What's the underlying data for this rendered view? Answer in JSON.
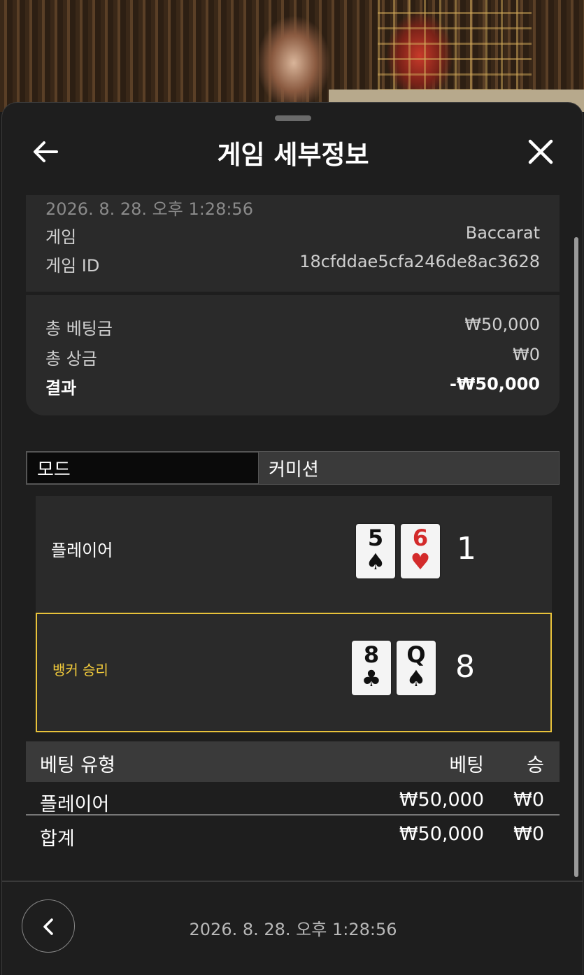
{
  "header": {
    "title": "게임 세부정보"
  },
  "info": {
    "timestamp": "2026. 8. 28. 오후 1:28:56",
    "game_label": "게임",
    "game_value": "Baccarat",
    "game_id_label": "게임 ID",
    "game_id_value": "18cfddae5cfa246de8ac3628"
  },
  "summary": {
    "total_bet_label": "총 베팅금",
    "total_bet_value": "₩50,000",
    "total_win_label": "총 상금",
    "total_win_value": "₩0",
    "result_label": "결과",
    "result_value": "-₩50,000"
  },
  "tabs": {
    "mode": "모드",
    "commission": "커미션"
  },
  "player": {
    "label": "플레이어",
    "cards": [
      {
        "rank": "5",
        "suit": "♠",
        "color": "black"
      },
      {
        "rank": "6",
        "suit": "♥",
        "color": "red"
      }
    ],
    "score": "1"
  },
  "banker": {
    "label": "뱅커 승리",
    "cards": [
      {
        "rank": "8",
        "suit": "♣",
        "color": "black"
      },
      {
        "rank": "Q",
        "suit": "♠",
        "color": "black"
      }
    ],
    "score": "8"
  },
  "bets_table": {
    "headers": [
      "베팅 유형",
      "베팅",
      "승"
    ],
    "rows": [
      {
        "type": "플레이어",
        "bet": "₩50,000",
        "win": "₩0"
      }
    ],
    "total": {
      "type": "합계",
      "bet": "₩50,000",
      "win": "₩0"
    }
  },
  "footer": {
    "timestamp": "2026. 8. 28. 오후 1:28:56"
  },
  "icons": {
    "back": "arrow-left-icon",
    "close": "close-icon",
    "nav_back": "chevron-left-icon"
  },
  "colors": {
    "accent": "#e8c23a",
    "card_red": "#d32b2b"
  }
}
